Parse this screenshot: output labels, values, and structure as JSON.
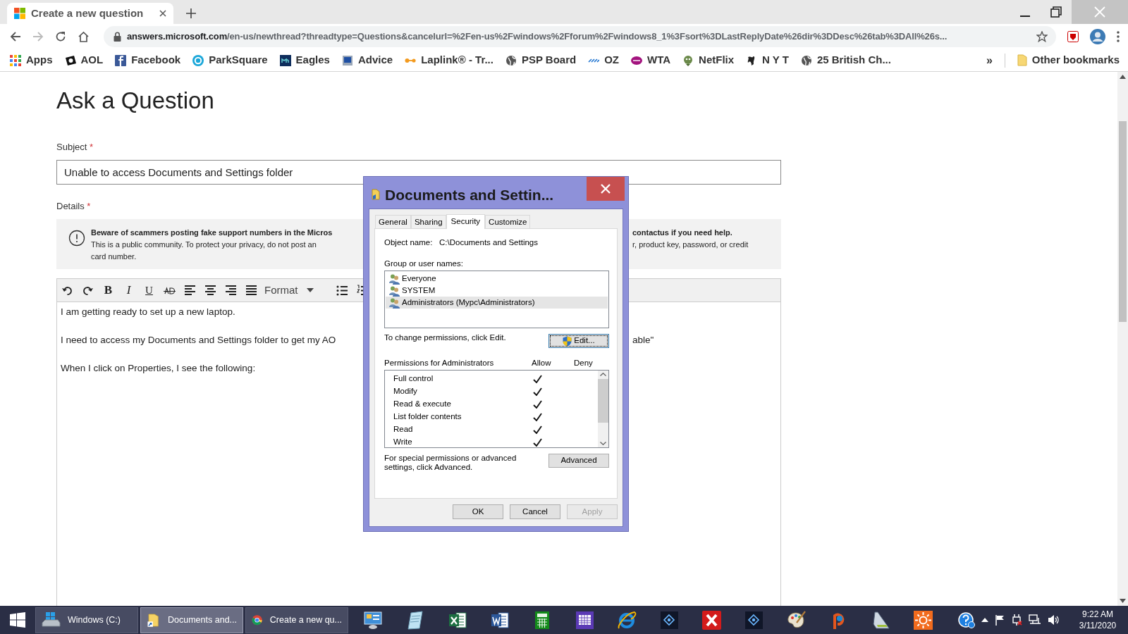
{
  "browser": {
    "tab": {
      "title": "Create a new question"
    },
    "address": {
      "host": "answers.microsoft.com",
      "path": "/en-us/newthread?threadtype=Questions&cancelurl=%2Fen-us%2Fwindows%2Fforum%2Fwindows8_1%3Fsort%3DLastReplyDate%26dir%3DDesc%26tab%3DAll%26s..."
    },
    "bookmarks": [
      {
        "label": "Apps",
        "kind": "grid"
      },
      {
        "label": "AOL",
        "kind": "dark-badge"
      },
      {
        "label": "Facebook",
        "kind": "blue-square"
      },
      {
        "label": "ParkSquare",
        "kind": "ring"
      },
      {
        "label": "Eagles",
        "kind": "navy-tile"
      },
      {
        "label": "Advice",
        "kind": "screen"
      },
      {
        "label": "Laplink® - Tr...",
        "kind": "link"
      },
      {
        "label": "PSP Board",
        "kind": "globe"
      },
      {
        "label": "OZ",
        "kind": "wave"
      },
      {
        "label": "WTA",
        "kind": "purple-oval"
      },
      {
        "label": "NetFlix",
        "kind": "creature"
      },
      {
        "label": "N Y T",
        "kind": "blackletter"
      },
      {
        "label": "25 British Ch...",
        "kind": "globe"
      }
    ],
    "more": "»",
    "other_bookmarks": "Other bookmarks"
  },
  "page": {
    "title": "Ask a Question",
    "subject": {
      "label": "Subject",
      "required": "*",
      "value": "Unable to access Documents and Settings folder"
    },
    "details": {
      "label": "Details",
      "required": "*"
    },
    "notice": [
      {
        "kind": "heading",
        "left": "Beware of scammers posting fake support numbers in the Micros",
        "right": "contactus if you need help."
      },
      {
        "kind": "body",
        "left": "This is a public community. To protect your privacy, do not post an",
        "right": "r, product key, password, or credit"
      },
      {
        "kind": "body",
        "left": "card number."
      }
    ],
    "toolbar": {
      "bold": "B",
      "italic": "I",
      "underline": "U",
      "format": "Format"
    },
    "paragraphs": [
      {
        "left": "I am getting ready to set up a new laptop."
      },
      {
        "left": "I need to access my Documents and Settings folder to get my AO",
        "right": "able\""
      },
      {
        "left": "When I click on Properties, I see the following:"
      }
    ]
  },
  "dialog": {
    "title": "Documents and Settin...",
    "tabs": [
      {
        "label": "General",
        "selected": false
      },
      {
        "label": "Sharing",
        "selected": false
      },
      {
        "label": "Security",
        "selected": true
      },
      {
        "label": "Customize",
        "selected": false
      }
    ],
    "object_label": "Object name:",
    "object_name": "C:\\Documents and Settings",
    "group_label": "Group or user names:",
    "users": [
      {
        "name": "Everyone",
        "selected": false
      },
      {
        "name": "SYSTEM",
        "selected": false
      },
      {
        "name": "Administrators (Mypc\\Administrators)",
        "selected": true
      }
    ],
    "change_hint": "To change permissions, click Edit.",
    "edit_button": "Edit...",
    "permissions_label": "Permissions for Administrators",
    "allow_header": "Allow",
    "deny_header": "Deny",
    "permissions": [
      {
        "name": "Full control",
        "allow": true,
        "deny": false
      },
      {
        "name": "Modify",
        "allow": true,
        "deny": false
      },
      {
        "name": "Read & execute",
        "allow": true,
        "deny": false
      },
      {
        "name": "List folder contents",
        "allow": true,
        "deny": false
      },
      {
        "name": "Read",
        "allow": true,
        "deny": false
      },
      {
        "name": "Write",
        "allow": true,
        "deny": false
      }
    ],
    "advanced_hint": "For special permissions or advanced settings, click Advanced.",
    "advanced_button": "Advanced",
    "buttons": [
      {
        "label": "OK",
        "disabled": false
      },
      {
        "label": "Cancel",
        "disabled": false
      },
      {
        "label": "Apply",
        "disabled": true
      }
    ]
  },
  "taskbar": {
    "windows": [
      {
        "label": "Windows (C:)",
        "kind": "drive",
        "selected": false
      },
      {
        "label": "Documents and...",
        "kind": "folder",
        "selected": true
      },
      {
        "label": "Create a new qu...",
        "kind": "browser",
        "selected": false
      }
    ],
    "clock": {
      "time": "9:22 AM",
      "date": "3/11/2020"
    }
  }
}
